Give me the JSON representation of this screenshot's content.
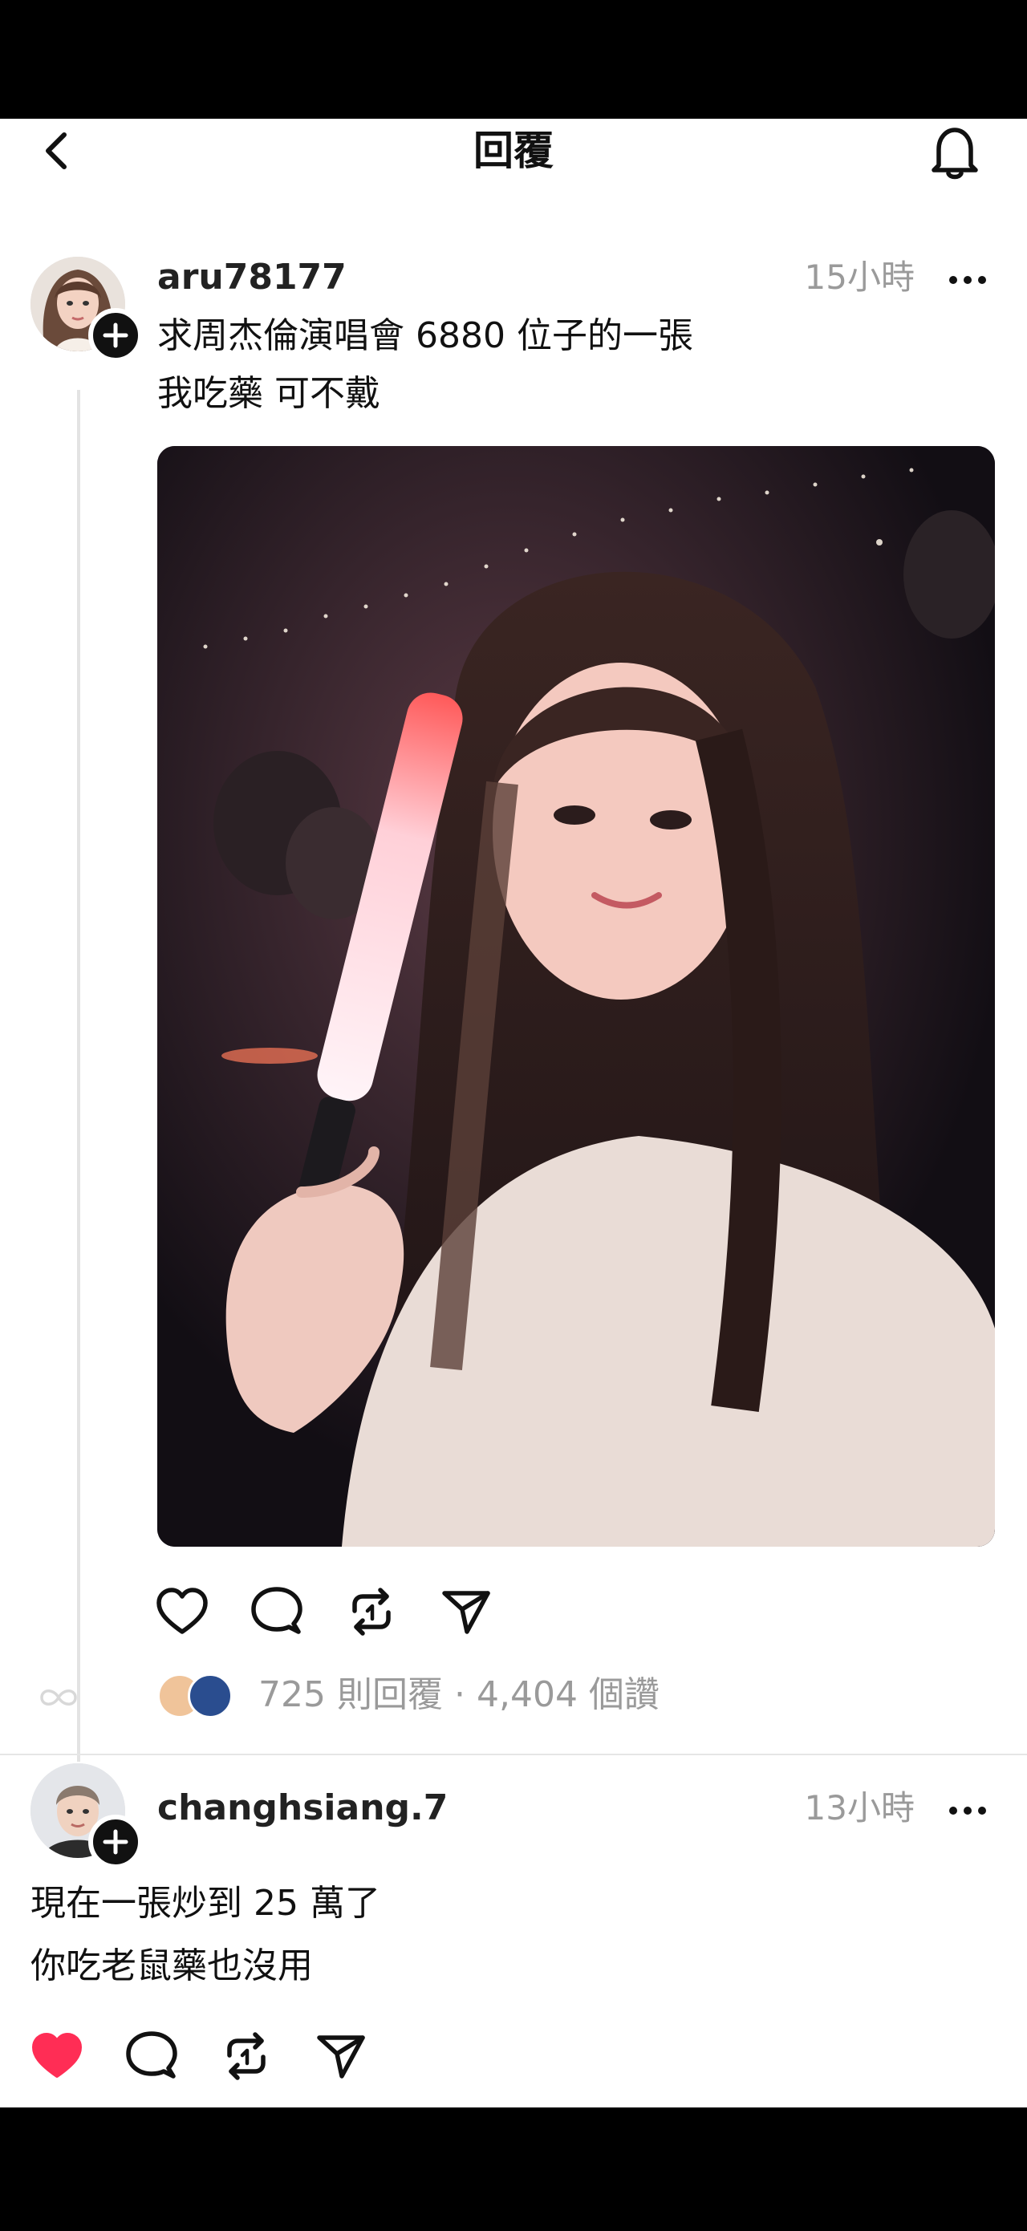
{
  "header": {
    "title": "回覆",
    "back_icon": "chevron-left-icon",
    "bell_icon": "bell-icon"
  },
  "post": {
    "username": "aru78177",
    "time": "15小時",
    "lines": [
      "求周杰倫演唱會 6880 位子的一張",
      "我吃藥 可不戴"
    ],
    "stats": {
      "replies": "725 則回覆",
      "likes": "4,404 個讚"
    },
    "actions": [
      "heart-icon",
      "comment-icon",
      "repost-icon",
      "send-icon"
    ]
  },
  "reply": {
    "username": "changhsiang.7",
    "time": "13小時",
    "lines": [
      "現在一張炒到 25 萬了",
      "你吃老鼠藥也沒用"
    ],
    "liked": true,
    "actions": [
      "heart-filled-icon",
      "comment-icon",
      "repost-icon",
      "send-icon"
    ]
  },
  "colors": {
    "liked": "#ff2d55",
    "muted_text": "#9a9a9a",
    "primary_text": "#111111"
  }
}
